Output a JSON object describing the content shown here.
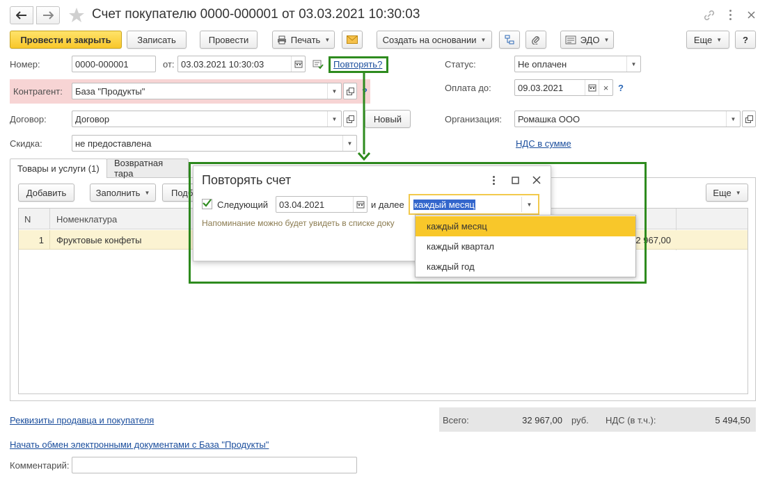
{
  "window": {
    "title": "Счет покупателю 0000-000001 от 03.03.2021 10:30:03"
  },
  "toolbar": {
    "post_close": "Провести и закрыть",
    "save": "Записать",
    "post": "Провести",
    "print": "Печать",
    "create_based": "Создать на основании",
    "edo": "ЭДО",
    "more": "Еще",
    "help": "?"
  },
  "header": {
    "number_label": "Номер:",
    "number_value": "0000-000001",
    "from_label": "от:",
    "date_value": "03.03.2021 10:30:03",
    "repeat_link": "Повторять?",
    "status_label": "Статус:",
    "status_value": "Не оплачен",
    "pay_until_label": "Оплата до:",
    "pay_until_value": "09.03.2021",
    "counterparty_label": "Контрагент:",
    "counterparty_value": "База \"Продукты\"",
    "contract_label": "Договор:",
    "contract_value": "Договор",
    "new_button": "Новый",
    "org_label": "Организация:",
    "org_value": "Ромашка ООО",
    "discount_label": "Скидка:",
    "discount_value": "не предоставлена",
    "vat_link": "НДС в сумме",
    "question": "?",
    "clear_x": "×"
  },
  "tabs": {
    "goods": "Товары и услуги (1)",
    "returnable": "Возвратная тара"
  },
  "table_toolbar": {
    "add": "Добавить",
    "fill": "Заполнить",
    "select": "Подб",
    "more": "Еще"
  },
  "table": {
    "col_n": "N",
    "col_item": "Номенклатура",
    "rows": [
      {
        "n": "1",
        "item": "Фруктовые конфеты",
        "amount": "2 967,00"
      }
    ]
  },
  "footer": {
    "requisites_link": "Реквизиты продавца и покупателя",
    "edo_link": "Начать обмен электронными документами с База \"Продукты\"",
    "comment_label": "Комментарий:",
    "total_label": "Всего:",
    "total_value": "32 967,00",
    "currency": "руб.",
    "vat_label": "НДС (в т.ч.):",
    "vat_value": "5 494,50"
  },
  "dialog": {
    "title": "Повторять счет",
    "next_label": "Следующий",
    "next_checked": true,
    "next_date": "03.04.2021",
    "then_label": "и далее",
    "period_value": "каждый месяц",
    "hint": "Напоминание можно будет увидеть в списке доку",
    "options": [
      "каждый месяц",
      "каждый квартал",
      "каждый год"
    ],
    "selected_option": "каждый месяц"
  },
  "colors": {
    "accent_green": "#2e8b1e",
    "primary_yellow": "#f8c72a",
    "selected_row": "#fbf3d2",
    "link_blue": "#1a4d9c",
    "required_bg": "#f7d4d4"
  }
}
